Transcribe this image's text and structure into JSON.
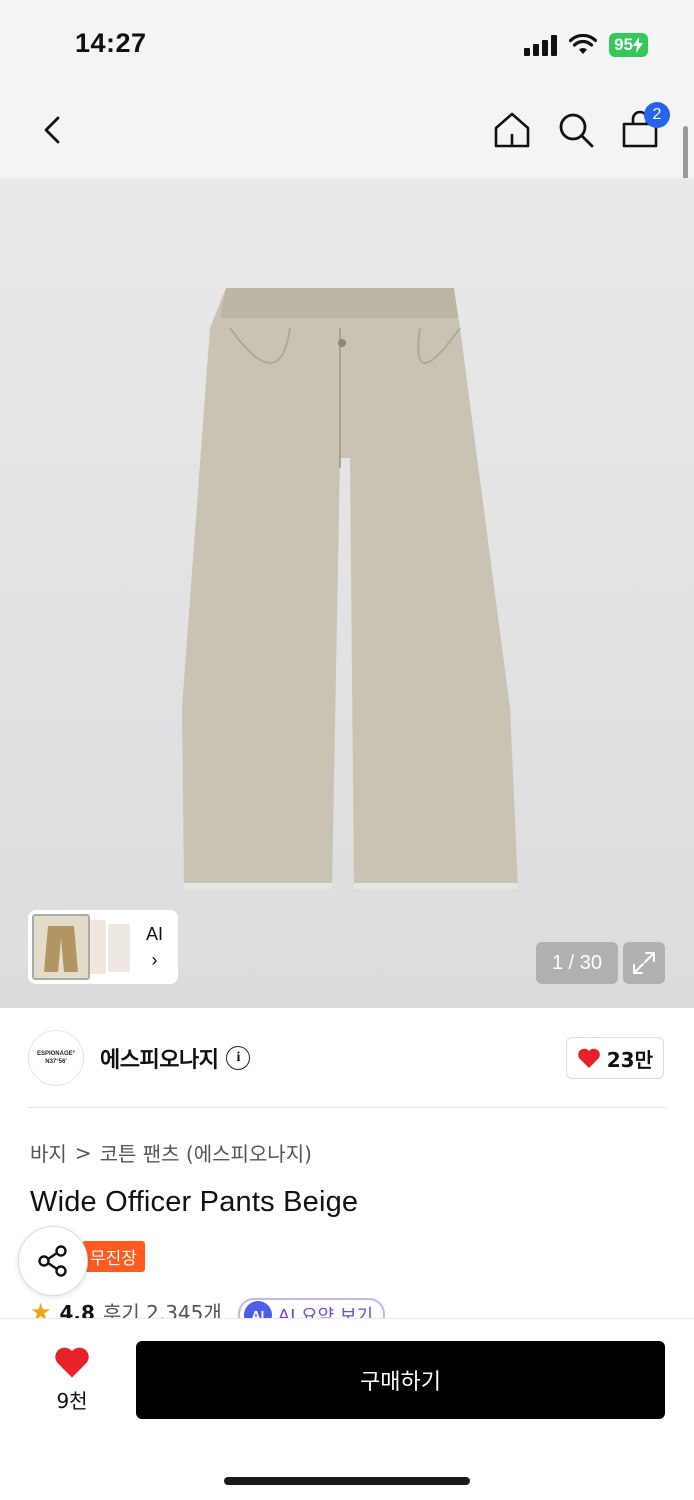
{
  "status_bar": {
    "time": "14:27",
    "battery": "95"
  },
  "nav": {
    "cart_count": "2"
  },
  "gallery": {
    "ai_label": "AI",
    "ai_arrow": "›",
    "page_counter": "1 / 30"
  },
  "brand": {
    "logo_line1": "ESPIONAGE°",
    "logo_line2": "N37°56'",
    "name": "에스피오나지",
    "likes": "23만"
  },
  "product": {
    "breadcrumb": [
      "바지",
      "코튼 팬츠 (에스피오나지)"
    ],
    "breadcrumb_sep": ">",
    "title": "Wide Officer Pants Beige",
    "badge": "무진장",
    "rating": "4.8",
    "reviews": "후기 2,345개",
    "ai_summary_badge": "AI",
    "ai_summary_label": "AI 요약 보기"
  },
  "bottom": {
    "wish_count": "9천",
    "buy_label": "구매하기"
  },
  "colors": {
    "accent_badge": "#ff5a1f",
    "cart_badge": "#2563eb",
    "battery": "#34c759",
    "heart": "#e8202a",
    "buy_button": "#000000"
  },
  "icons": [
    "back-icon",
    "home-icon",
    "search-icon",
    "cart-icon",
    "expand-icon",
    "info-icon",
    "heart-icon",
    "share-icon",
    "star-icon"
  ]
}
